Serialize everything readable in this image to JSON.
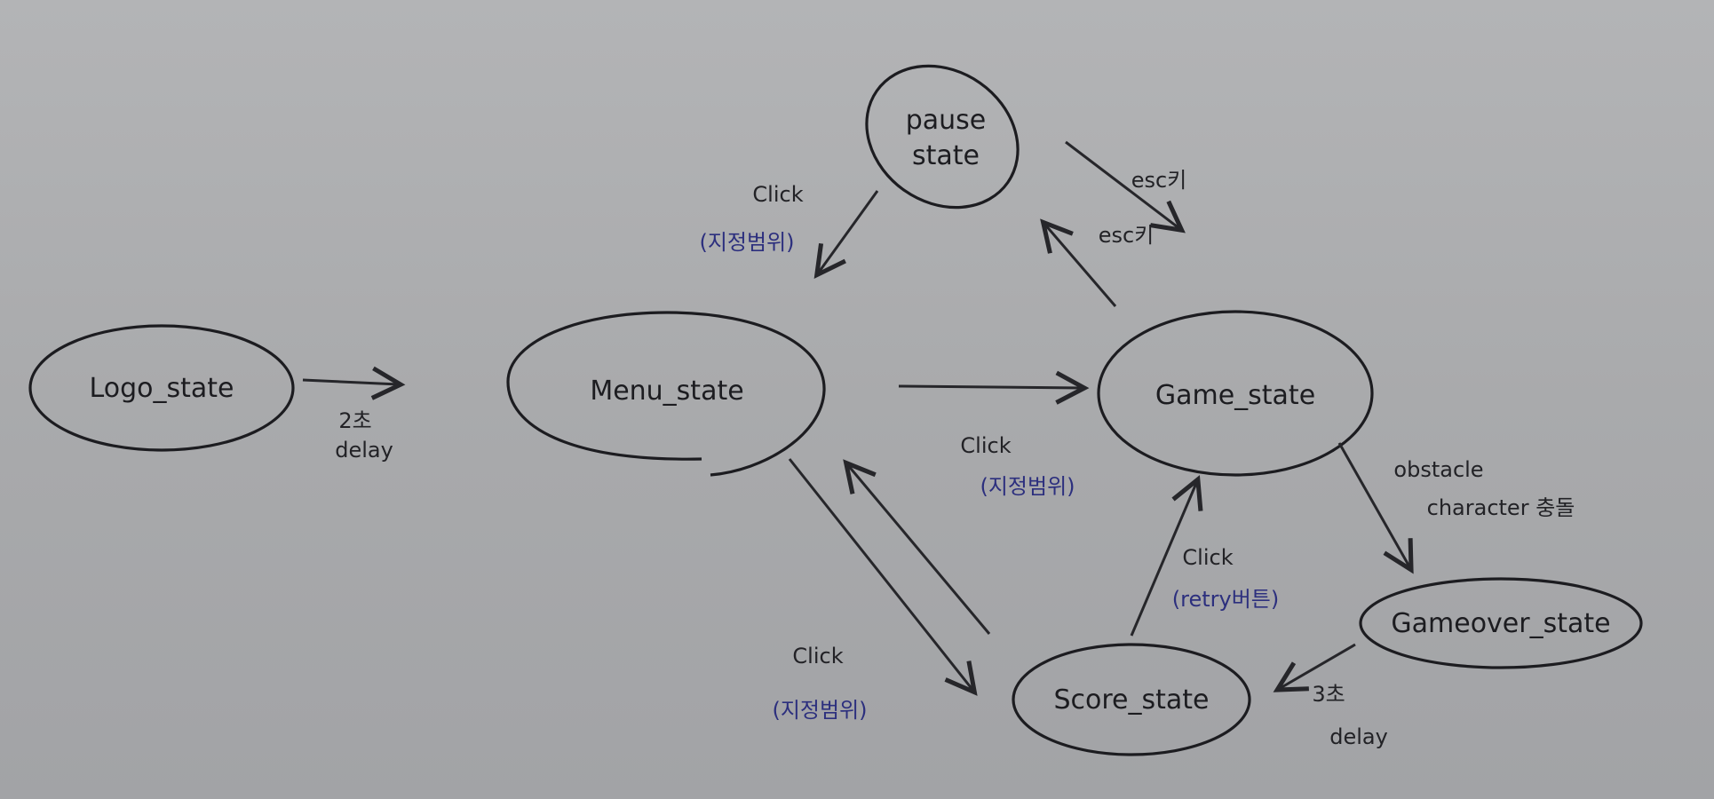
{
  "states": {
    "logo": "Logo_state",
    "menu": "Menu_state",
    "pause_line1": "pause",
    "pause_line2": "state",
    "game": "Game_state",
    "gameover": "Gameover_state",
    "score": "Score_state"
  },
  "transitions": {
    "logo_to_menu": {
      "line1": "2초",
      "line2": "delay"
    },
    "pause_to_menu": {
      "line1": "Click",
      "line2": "(지정범위)"
    },
    "pause_to_game": {
      "label": "esc키"
    },
    "game_to_pause": {
      "label": "esc키"
    },
    "score_to_menu": {
      "line1": "Click",
      "line2": "(지정범위)"
    },
    "menu_to_score": {
      "line1": "Click",
      "line2": "(지정범위)"
    },
    "score_to_game": {
      "line1": "Click",
      "line2": "(retry버튼)"
    },
    "game_to_gameover": {
      "line1": "obstacle",
      "line2": "character 충돌"
    },
    "gameover_to_score": {
      "line1": "3초",
      "line2": "delay"
    }
  },
  "colors": {
    "ink": "#1c1c20",
    "blue_ink": "#2c2f7e",
    "paper": "#a9aaac"
  }
}
